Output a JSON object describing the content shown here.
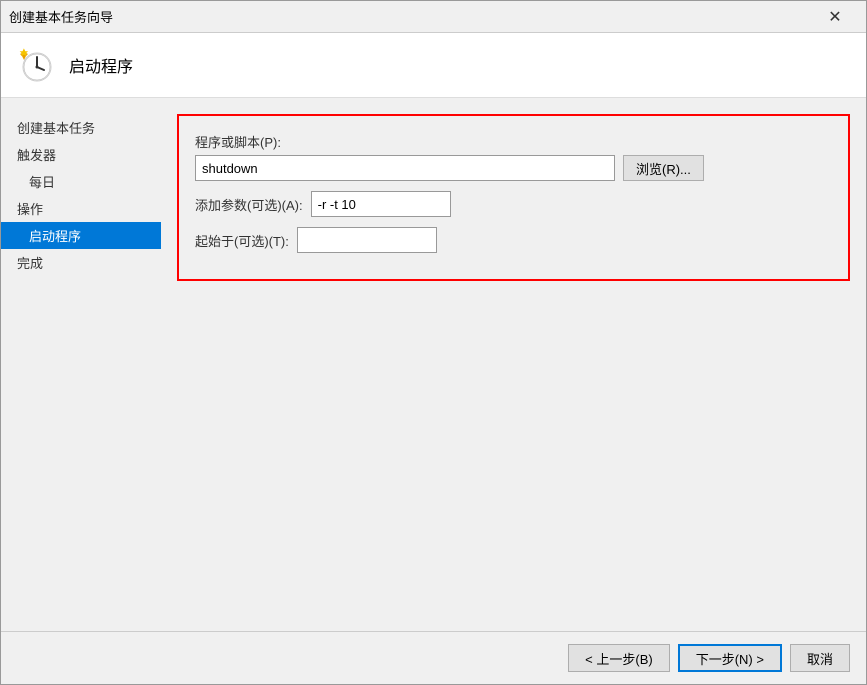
{
  "dialog": {
    "title": "创建基本任务向导",
    "close_icon": "✕"
  },
  "header": {
    "title": "启动程序"
  },
  "sidebar": {
    "items": [
      {
        "label": "创建基本任务",
        "active": false,
        "indented": false
      },
      {
        "label": "触发器",
        "active": false,
        "indented": false
      },
      {
        "label": "每日",
        "active": false,
        "indented": true
      },
      {
        "label": "操作",
        "active": false,
        "indented": false
      },
      {
        "label": "启动程序",
        "active": true,
        "indented": true
      },
      {
        "label": "完成",
        "active": false,
        "indented": false
      }
    ]
  },
  "form": {
    "program_label": "程序或脚本(P):",
    "program_value": "shutdown",
    "browse_label": "浏览(R)...",
    "params_label": "添加参数(可选)(A):",
    "params_value": "-r -t 10",
    "start_label": "起始于(可选)(T):",
    "start_value": ""
  },
  "footer": {
    "back_label": "< 上一步(B)",
    "next_label": "下一步(N) >",
    "cancel_label": "取消"
  }
}
